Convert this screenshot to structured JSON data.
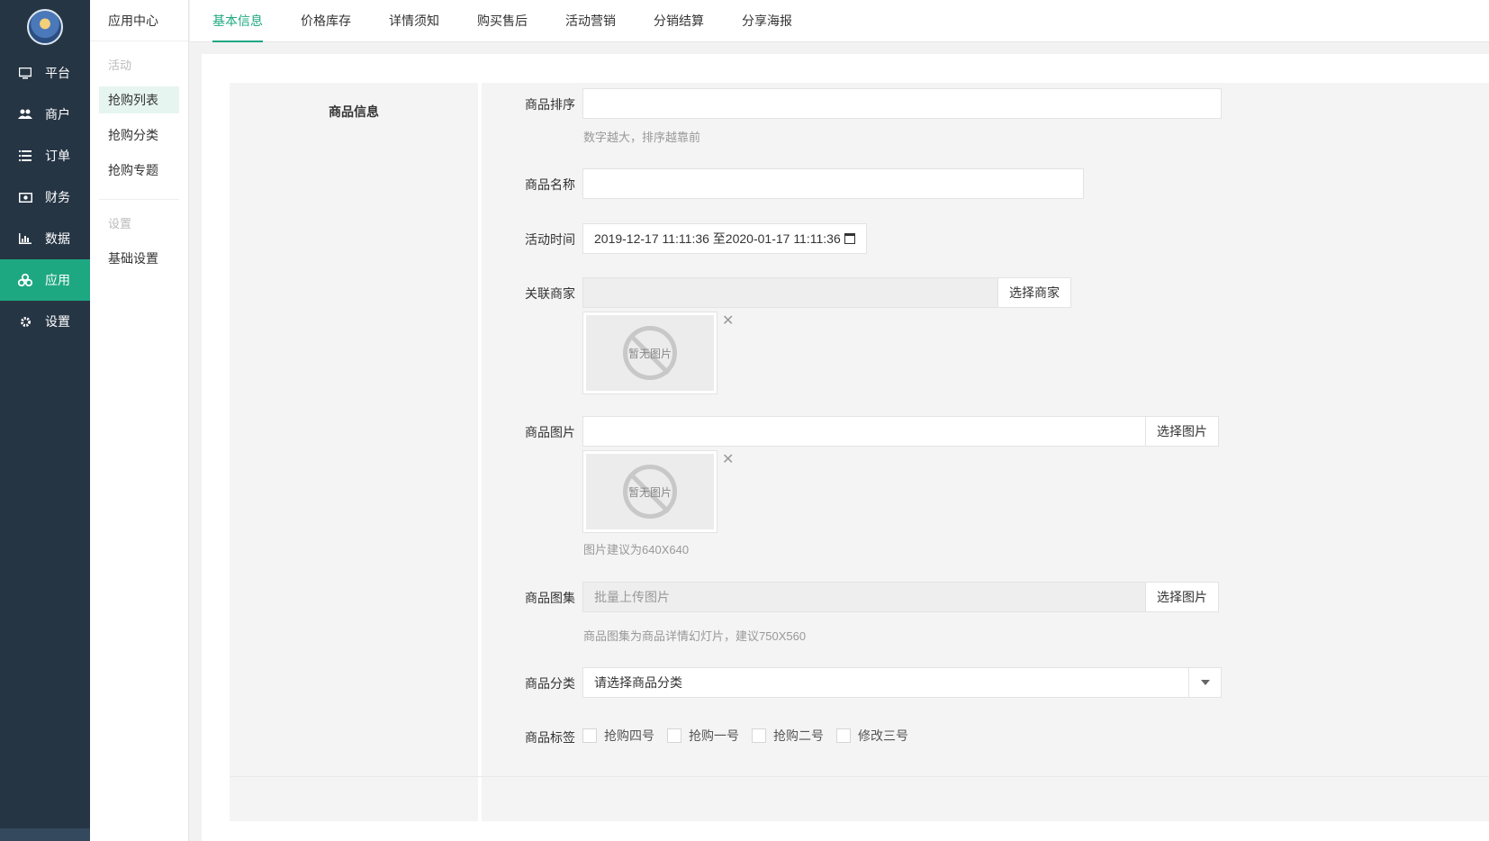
{
  "sidebar": {
    "items": [
      {
        "label": "平台",
        "icon": "monitor-icon"
      },
      {
        "label": "商户",
        "icon": "users-icon"
      },
      {
        "label": "订单",
        "icon": "list-icon"
      },
      {
        "label": "财务",
        "icon": "money-icon"
      },
      {
        "label": "数据",
        "icon": "bar-chart-icon"
      },
      {
        "label": "应用",
        "icon": "apps-icon",
        "active": true
      },
      {
        "label": "设置",
        "icon": "gear-icon"
      }
    ]
  },
  "subbar": {
    "title": "应用中心",
    "group1": {
      "head": "活动",
      "items": [
        "抢购列表",
        "抢购分类",
        "抢购专题"
      ]
    },
    "group2": {
      "head": "设置",
      "items": [
        "基础设置"
      ]
    }
  },
  "tabs": [
    "基本信息",
    "价格库存",
    "详情须知",
    "购买售后",
    "活动营销",
    "分销结算",
    "分享海报"
  ],
  "form": {
    "section_title": "商品信息",
    "sort": {
      "label": "商品排序",
      "value": "",
      "help": "数字越大，排序越靠前"
    },
    "name": {
      "label": "商品名称",
      "value": ""
    },
    "time": {
      "label": "活动时间",
      "value": "2019-12-17 11:11:36 至2020-01-17 11:11:36"
    },
    "merchant": {
      "label": "关联商家",
      "value": "",
      "button": "选择商家",
      "thumb_text": "暂无图片"
    },
    "image": {
      "label": "商品图片",
      "value": "",
      "button": "选择图片",
      "thumb_text": "暂无图片",
      "help": "图片建议为640X640"
    },
    "gallery": {
      "label": "商品图集",
      "placeholder": "批量上传图片",
      "button": "选择图片",
      "help": "商品图集为商品详情幻灯片，建议750X560"
    },
    "category": {
      "label": "商品分类",
      "value": "请选择商品分类"
    },
    "tags": {
      "label": "商品标签",
      "options": [
        "抢购四号",
        "抢购一号",
        "抢购二号",
        "修改三号"
      ]
    }
  },
  "colors": {
    "accent": "#1ea882",
    "sidebar_bg": "#263544"
  }
}
